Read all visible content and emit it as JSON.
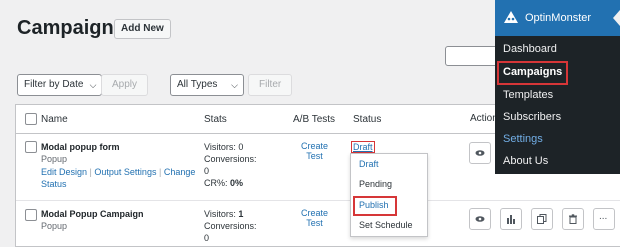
{
  "page": {
    "title": "Campaigns",
    "add_new": "Add New"
  },
  "filters": {
    "date": "Filter by Date",
    "apply": "Apply",
    "type": "All Types",
    "filter": "Filter"
  },
  "table": {
    "headers": {
      "name": "Name",
      "stats": "Stats",
      "ab": "A/B Tests",
      "status": "Status",
      "actions": "Actions"
    },
    "rows": [
      {
        "name": "Modal popup form",
        "type": "Popup",
        "links": {
          "edit": "Edit Design",
          "output": "Output Settings",
          "change": "Change",
          "status": "Status"
        },
        "visitors": "Visitors: 0",
        "conversions_label": "Conversions:",
        "conversions": "0",
        "cr_label": "CR%:",
        "cr": "0%",
        "ab_line1": "Create",
        "ab_line2": "Test",
        "status": "Draft"
      },
      {
        "name": "Modal Popup Campaign",
        "type": "Popup",
        "visitors_label": "Visitors:",
        "visitors": "1",
        "conversions_label": "Conversions:",
        "conversions": "0",
        "ab_line1": "Create",
        "ab_line2": "Test"
      }
    ]
  },
  "status_dropdown": {
    "options": [
      "Draft",
      "Pending",
      "Publish",
      "Set Schedule"
    ],
    "highlighted": "Publish"
  },
  "action_icons": [
    "eye-icon",
    "bar-chart-icon",
    "copy-icon",
    "trash-icon",
    "more-icon"
  ],
  "more_label": "...",
  "admin_menu": {
    "brand": "OptinMonster",
    "items": [
      "Dashboard",
      "Campaigns",
      "Templates",
      "Subscribers",
      "Settings",
      "About Us"
    ],
    "current": "Campaigns",
    "hover": "Settings"
  },
  "colors": {
    "accent": "#2271b1",
    "highlight": "#d63638",
    "menu_bg": "#1d2327"
  }
}
